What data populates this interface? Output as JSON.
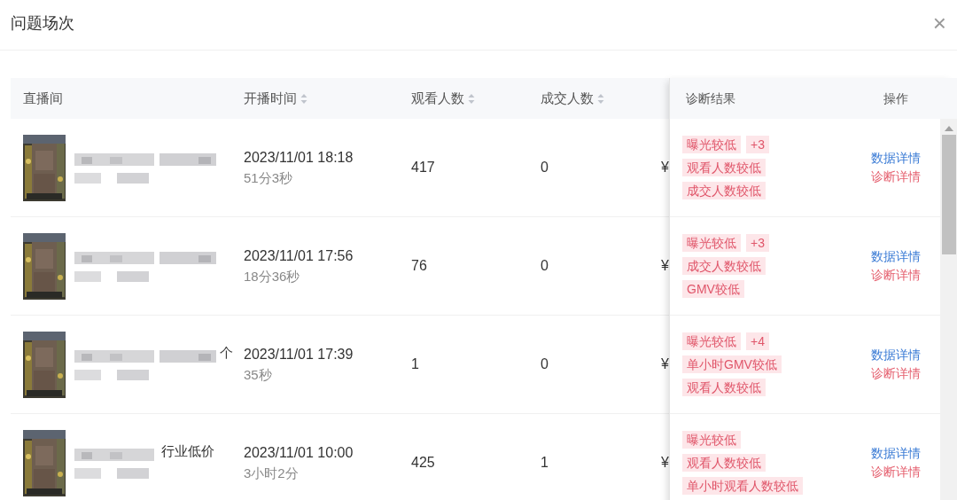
{
  "dialog": {
    "title": "问题场次",
    "close": "×"
  },
  "table": {
    "columns": [
      {
        "label": "直播间",
        "sortable": false
      },
      {
        "label": "开播时间",
        "sortable": true
      },
      {
        "label": "观看人数",
        "sortable": true
      },
      {
        "label": "成交人数",
        "sortable": true
      }
    ],
    "fixed_columns": [
      {
        "label": "诊断结果"
      },
      {
        "label": "操作"
      }
    ],
    "rows": [
      {
        "start_time": "2023/11/01 18:18",
        "duration": "51分3秒",
        "viewers": "417",
        "buyers": "0",
        "column_5": "¥",
        "tags": [
          "曝光较低",
          "观看人数较低",
          "成交人数较低"
        ],
        "more": "+3",
        "actions": [
          {
            "label": "数据详情",
            "kind": "data"
          },
          {
            "label": "诊断详情",
            "kind": "diagnosis"
          }
        ]
      },
      {
        "start_time": "2023/11/01 17:56",
        "duration": "18分36秒",
        "viewers": "76",
        "buyers": "0",
        "column_5": "¥",
        "tags": [
          "曝光较低",
          "成交人数较低",
          "GMV较低"
        ],
        "more": "+3",
        "actions": [
          {
            "label": "数据详情",
            "kind": "data"
          },
          {
            "label": "诊断详情",
            "kind": "diagnosis"
          }
        ]
      },
      {
        "name_tail": "个",
        "start_time": "2023/11/01 17:39",
        "duration": "35秒",
        "viewers": "1",
        "buyers": "0",
        "column_5": "¥",
        "tags": [
          "曝光较低",
          "单小时GMV较低",
          "观看人数较低"
        ],
        "more": "+4",
        "actions": [
          {
            "label": "数据详情",
            "kind": "data"
          },
          {
            "label": "诊断详情",
            "kind": "diagnosis"
          }
        ]
      },
      {
        "name_tail": "行业低价",
        "start_time": "2023/11/01 10:00",
        "duration": "3小时2分",
        "viewers": "425",
        "buyers": "1",
        "column_5": "¥",
        "tags": [
          "曝光较低",
          "观看人数较低",
          "单小时观看人数较低"
        ],
        "actions": [
          {
            "label": "数据详情",
            "kind": "data"
          },
          {
            "label": "诊断详情",
            "kind": "diagnosis"
          }
        ]
      }
    ]
  }
}
